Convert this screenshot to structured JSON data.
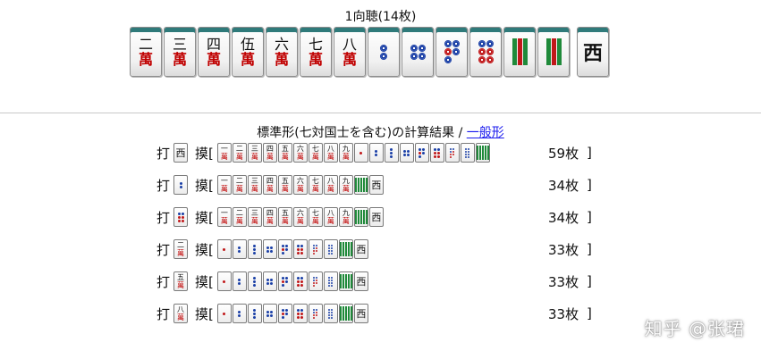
{
  "header": {
    "title": "1向聴(14枚)"
  },
  "hand": [
    {
      "kind": "man",
      "num": "二",
      "suit": "萬"
    },
    {
      "kind": "man",
      "num": "三",
      "suit": "萬"
    },
    {
      "kind": "man",
      "num": "四",
      "suit": "萬"
    },
    {
      "kind": "man",
      "num": "伍",
      "suit": "萬"
    },
    {
      "kind": "man",
      "num": "六",
      "suit": "萬"
    },
    {
      "kind": "man",
      "num": "七",
      "suit": "萬"
    },
    {
      "kind": "man",
      "num": "八",
      "suit": "萬"
    },
    {
      "kind": "pin",
      "n": 2
    },
    {
      "kind": "pin",
      "n": 4
    },
    {
      "kind": "pin",
      "n": 5
    },
    {
      "kind": "pin",
      "n": 6
    },
    {
      "kind": "sou",
      "n": 3
    },
    {
      "kind": "sou",
      "n": 3
    },
    {
      "kind": "hon",
      "char": "西",
      "gap": true
    }
  ],
  "results": {
    "heading": "標準形(七対国士を含む)の計算結果 / ",
    "link": "一般形",
    "discard_label": "打",
    "draw_label": "摸[",
    "close_label": "]",
    "rows": [
      {
        "discard": {
          "kind": "hon",
          "char": "西"
        },
        "count": "59枚",
        "draws": [
          {
            "kind": "man",
            "num": "一"
          },
          {
            "kind": "man",
            "num": "二"
          },
          {
            "kind": "man",
            "num": "三"
          },
          {
            "kind": "man",
            "num": "四"
          },
          {
            "kind": "man",
            "num": "五"
          },
          {
            "kind": "man",
            "num": "六"
          },
          {
            "kind": "man",
            "num": "七"
          },
          {
            "kind": "man",
            "num": "八"
          },
          {
            "kind": "man",
            "num": "九"
          },
          {
            "kind": "pin",
            "n": 1
          },
          {
            "kind": "pin",
            "n": 2
          },
          {
            "kind": "pin",
            "n": 3
          },
          {
            "kind": "pin",
            "n": 4
          },
          {
            "kind": "pin",
            "n": 5
          },
          {
            "kind": "pin",
            "n": 6
          },
          {
            "kind": "pin",
            "n": 7
          },
          {
            "kind": "pin",
            "n": 8
          },
          {
            "kind": "sou",
            "n": 5
          }
        ]
      },
      {
        "discard": {
          "kind": "pin",
          "n": 2
        },
        "count": "34枚",
        "draws": [
          {
            "kind": "man",
            "num": "一"
          },
          {
            "kind": "man",
            "num": "二"
          },
          {
            "kind": "man",
            "num": "三"
          },
          {
            "kind": "man",
            "num": "四"
          },
          {
            "kind": "man",
            "num": "五"
          },
          {
            "kind": "man",
            "num": "六"
          },
          {
            "kind": "man",
            "num": "七"
          },
          {
            "kind": "man",
            "num": "八"
          },
          {
            "kind": "man",
            "num": "九"
          },
          {
            "kind": "sou",
            "n": 5
          },
          {
            "kind": "hon",
            "char": "西"
          }
        ]
      },
      {
        "discard": {
          "kind": "pin",
          "n": 6
        },
        "count": "34枚",
        "draws": [
          {
            "kind": "man",
            "num": "一"
          },
          {
            "kind": "man",
            "num": "二"
          },
          {
            "kind": "man",
            "num": "三"
          },
          {
            "kind": "man",
            "num": "四"
          },
          {
            "kind": "man",
            "num": "五"
          },
          {
            "kind": "man",
            "num": "六"
          },
          {
            "kind": "man",
            "num": "七"
          },
          {
            "kind": "man",
            "num": "八"
          },
          {
            "kind": "man",
            "num": "九"
          },
          {
            "kind": "sou",
            "n": 5
          },
          {
            "kind": "hon",
            "char": "西"
          }
        ]
      },
      {
        "discard": {
          "kind": "man",
          "num": "二"
        },
        "count": "33枚",
        "draws": [
          {
            "kind": "pin",
            "n": 1
          },
          {
            "kind": "pin",
            "n": 2
          },
          {
            "kind": "pin",
            "n": 3
          },
          {
            "kind": "pin",
            "n": 4
          },
          {
            "kind": "pin",
            "n": 5
          },
          {
            "kind": "pin",
            "n": 6
          },
          {
            "kind": "pin",
            "n": 7
          },
          {
            "kind": "pin",
            "n": 8
          },
          {
            "kind": "sou",
            "n": 5
          },
          {
            "kind": "hon",
            "char": "西"
          }
        ]
      },
      {
        "discard": {
          "kind": "man",
          "num": "五"
        },
        "count": "33枚",
        "draws": [
          {
            "kind": "pin",
            "n": 1
          },
          {
            "kind": "pin",
            "n": 2
          },
          {
            "kind": "pin",
            "n": 3
          },
          {
            "kind": "pin",
            "n": 4
          },
          {
            "kind": "pin",
            "n": 5
          },
          {
            "kind": "pin",
            "n": 6
          },
          {
            "kind": "pin",
            "n": 7
          },
          {
            "kind": "pin",
            "n": 8
          },
          {
            "kind": "sou",
            "n": 5
          },
          {
            "kind": "hon",
            "char": "西"
          }
        ]
      },
      {
        "discard": {
          "kind": "man",
          "num": "八"
        },
        "count": "33枚",
        "draws": [
          {
            "kind": "pin",
            "n": 1
          },
          {
            "kind": "pin",
            "n": 2
          },
          {
            "kind": "pin",
            "n": 3
          },
          {
            "kind": "pin",
            "n": 4
          },
          {
            "kind": "pin",
            "n": 5
          },
          {
            "kind": "pin",
            "n": 6
          },
          {
            "kind": "pin",
            "n": 7
          },
          {
            "kind": "pin",
            "n": 8
          },
          {
            "kind": "sou",
            "n": 5
          },
          {
            "kind": "hon",
            "char": "西"
          }
        ]
      }
    ]
  },
  "watermark": "知乎 @张珺",
  "colors": {
    "man_red": "#c00000",
    "pin_blue": "#1a3fa6",
    "pin_red": "#c0181a",
    "sou_green": "#1f8a3a",
    "tile_back": "#2f7a7a",
    "link": "#1a1aee"
  }
}
